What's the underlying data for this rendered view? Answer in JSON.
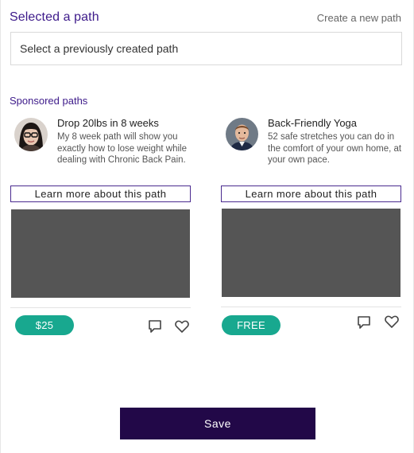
{
  "header": {
    "title": "Selected a path",
    "create_link": "Create a new path"
  },
  "path_select": {
    "value": "Select a previously created path"
  },
  "sponsored": {
    "heading": "Sponsored paths",
    "cards": [
      {
        "title": "Drop 20lbs in 8 weeks",
        "description": "My 8 week path will show you exactly how to lose weight while dealing with Chronic Back Pain.",
        "learn_more": "Learn more about this path",
        "price": "$25",
        "avatar_icon": "woman-avatar",
        "comment_icon": "comment-icon",
        "heart_icon": "heart-icon"
      },
      {
        "title": "Back-Friendly Yoga",
        "description": "52 safe stretches you can do in the comfort of your own home, at your own pace.",
        "learn_more": "Learn more about this path",
        "price": "FREE",
        "avatar_icon": "man-avatar",
        "comment_icon": "comment-icon",
        "heart_icon": "heart-icon"
      }
    ]
  },
  "footer": {
    "save_label": "Save"
  },
  "colors": {
    "accent": "#3d1a8a",
    "price_badge": "#18a88f",
    "save_button": "#220848",
    "media_placeholder": "#555555"
  }
}
